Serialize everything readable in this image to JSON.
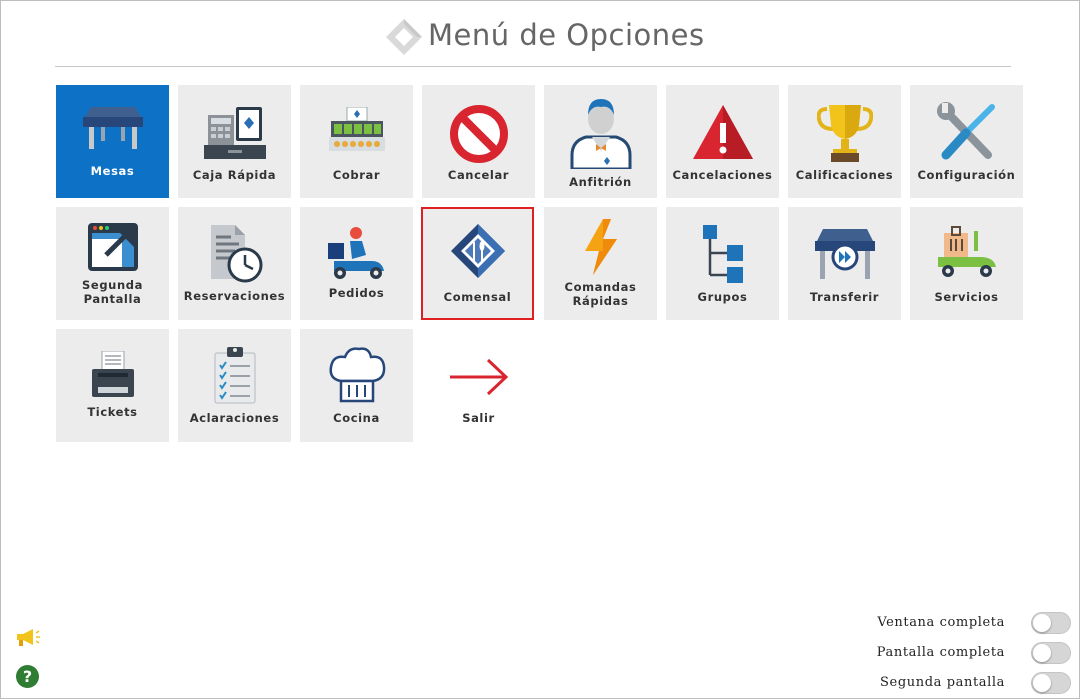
{
  "header": {
    "title": "Menú de Opciones",
    "logo_icon": "diamond-logo-icon"
  },
  "tiles": [
    {
      "label": "Mesas",
      "icon": "table-icon"
    },
    {
      "label": "Caja Rápida",
      "icon": "cash-register-icon"
    },
    {
      "label": "Cobrar",
      "icon": "cash-drawer-icon"
    },
    {
      "label": "Cancelar",
      "icon": "prohibited-icon"
    },
    {
      "label": "Anfitrión",
      "icon": "host-icon"
    },
    {
      "label": "Cancelaciones",
      "icon": "warning-icon"
    },
    {
      "label": "Calificaciones",
      "icon": "trophy-icon"
    },
    {
      "label": "Configuración",
      "icon": "tools-icon"
    },
    {
      "label": "Segunda\nPantalla",
      "icon": "second-screen-icon"
    },
    {
      "label": "Reservaciones",
      "icon": "reservations-clock-icon"
    },
    {
      "label": "Pedidos",
      "icon": "delivery-scooter-icon"
    },
    {
      "label": "Comensal",
      "icon": "diner-logo-icon"
    },
    {
      "label": "Comandas\nRápidas",
      "icon": "lightning-icon"
    },
    {
      "label": "Grupos",
      "icon": "groups-tree-icon"
    },
    {
      "label": "Transferir",
      "icon": "transfer-table-icon"
    },
    {
      "label": "Servicios",
      "icon": "services-scooter-icon"
    },
    {
      "label": "Tickets",
      "icon": "ticket-printer-icon"
    },
    {
      "label": "Aclaraciones",
      "icon": "clipboard-checklist-icon"
    },
    {
      "label": "Cocina",
      "icon": "chef-hat-icon"
    },
    {
      "label": "Salir",
      "icon": "arrow-right-icon"
    }
  ],
  "toggles": [
    {
      "label": "Ventana completa",
      "on": false
    },
    {
      "label": "Pantalla completa",
      "on": false
    },
    {
      "label": "Segunda pantalla",
      "on": false
    }
  ],
  "footer": {
    "help_glyph": "?",
    "announce_icon": "megaphone-icon",
    "help_icon": "help-icon"
  },
  "colors": {
    "active_tile": "#0d72c5",
    "tile_bg": "#ececec",
    "selected_border": "#e02020"
  }
}
